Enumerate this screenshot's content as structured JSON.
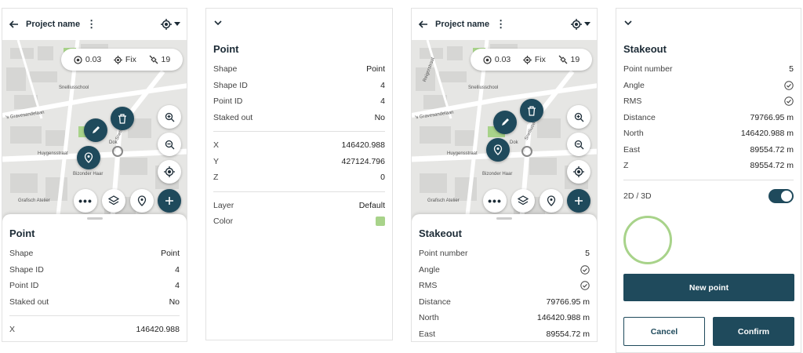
{
  "project_name": "Project name",
  "gps_status": {
    "accuracy": "0.03",
    "fix": "Fix",
    "satellites": "19"
  },
  "map_labels": {
    "snelliusschool": "Snelliusschool",
    "gravesandelaan": "'s Gravesandelaan",
    "huygensstraat": "Huygensstraat",
    "bizonder_haar": "Bizonder Haar",
    "grafisch_atelier": "Grafisch Atelier",
    "snelliusweg": "Snelliusweg",
    "reigerstraat": "Reigerstraat",
    "dok": "Dok"
  },
  "point": {
    "title": "Point",
    "rows": [
      {
        "label": "Shape",
        "value": "Point"
      },
      {
        "label": "Shape ID",
        "value": "4"
      },
      {
        "label": "Point ID",
        "value": "4"
      },
      {
        "label": "Staked out",
        "value": "No"
      }
    ],
    "coords": [
      {
        "label": "X",
        "value": "146420.988"
      },
      {
        "label": "Y",
        "value": "427124.796"
      },
      {
        "label": "Z",
        "value": "0"
      }
    ],
    "layer_label": "Layer",
    "layer_value": "Default",
    "color_label": "Color",
    "color_value": "#a8d38a"
  },
  "stakeout": {
    "title": "Stakeout",
    "point_number_label": "Point number",
    "point_number": "5",
    "angle_label": "Angle",
    "rms_label": "RMS",
    "distance_label": "Distance",
    "distance": "79766.95 m",
    "north_label": "North",
    "north": "146420.988 m",
    "east_label": "East",
    "east": "89554.72 m",
    "z_label": "Z",
    "z": "89554.72 m",
    "mode_label": "2D / 3D",
    "mode_on": true,
    "new_point": "New point",
    "cancel": "Cancel",
    "confirm": "Confirm"
  },
  "colors": {
    "accent": "#1f4a5c",
    "green": "#a8d38a"
  }
}
